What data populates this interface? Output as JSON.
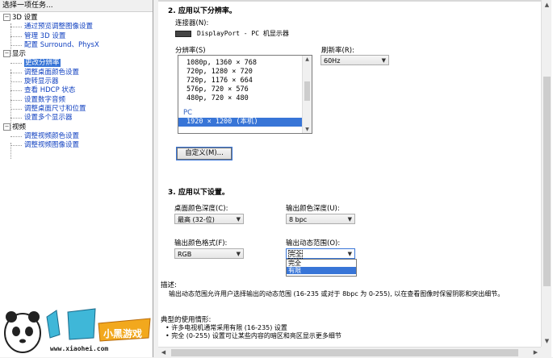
{
  "left": {
    "header": "选择一项任务...",
    "categories": [
      {
        "label": "3D 设置",
        "items": [
          "通过预览调整图像设置",
          "管理 3D 设置",
          "配置 Surround、PhysX"
        ]
      },
      {
        "label": "显示",
        "items": [
          "更改分辨率",
          "调整桌面颜色设置",
          "旋转显示器",
          "查看 HDCP 状态",
          "设置数字音频",
          "调整桌面尺寸和位置",
          "设置多个显示器"
        ]
      },
      {
        "label": "视频",
        "items": [
          "调整视频颜色设置",
          "调整视频图像设置"
        ]
      }
    ],
    "selected": "更改分辨率"
  },
  "section2": {
    "title": "2. 应用以下分辨率。",
    "connector_label": "连接器(N):",
    "connector_value": "DisplayPort - PC 机显示器",
    "resolution_label": "分辨率(S)",
    "resolutions": [
      "1080p, 1360 × 768",
      "720p, 1280 × 720",
      "720p, 1176 × 664",
      "576p, 720 × 576",
      "480p, 720 × 480"
    ],
    "group_label": "PC",
    "selected_resolution": "1920 × 1200 (本机)",
    "refresh_label": "刷新率(R):",
    "refresh_value": "60Hz",
    "custom_button": "自定义(M)..."
  },
  "section3": {
    "title": "3. 应用以下设置。",
    "desktop_depth_label": "桌面颜色深度(C):",
    "desktop_depth_value": "最高 (32-位)",
    "output_depth_label": "输出颜色深度(U):",
    "output_depth_value": "8 bpc",
    "output_format_label": "输出颜色格式(F):",
    "output_format_value": "RGB",
    "dynamic_range_label": "输出动态范围(O):",
    "dynamic_range_value": "完全",
    "dynamic_range_options": [
      "完全",
      "有限"
    ]
  },
  "description": {
    "title": "描述:",
    "text": "输出动态范围允许用户选择输出的动态范围 (16-235 或对于 8bpc 为 0-255), 以在查看图像时保留阴影和突出细节。"
  },
  "usage": {
    "title": "典型的使用情形:",
    "items": [
      "• 许多电视机通常采用有限 (16-235) 设置",
      "• 完全 (0-255) 设置可让某些内容的暗区和亮区显示更多细节"
    ]
  },
  "watermark": {
    "text": "小黑游戏",
    "url": "www.xiaohei.com"
  },
  "colors": {
    "selection": "#3875d7",
    "link": "#1040c0"
  }
}
